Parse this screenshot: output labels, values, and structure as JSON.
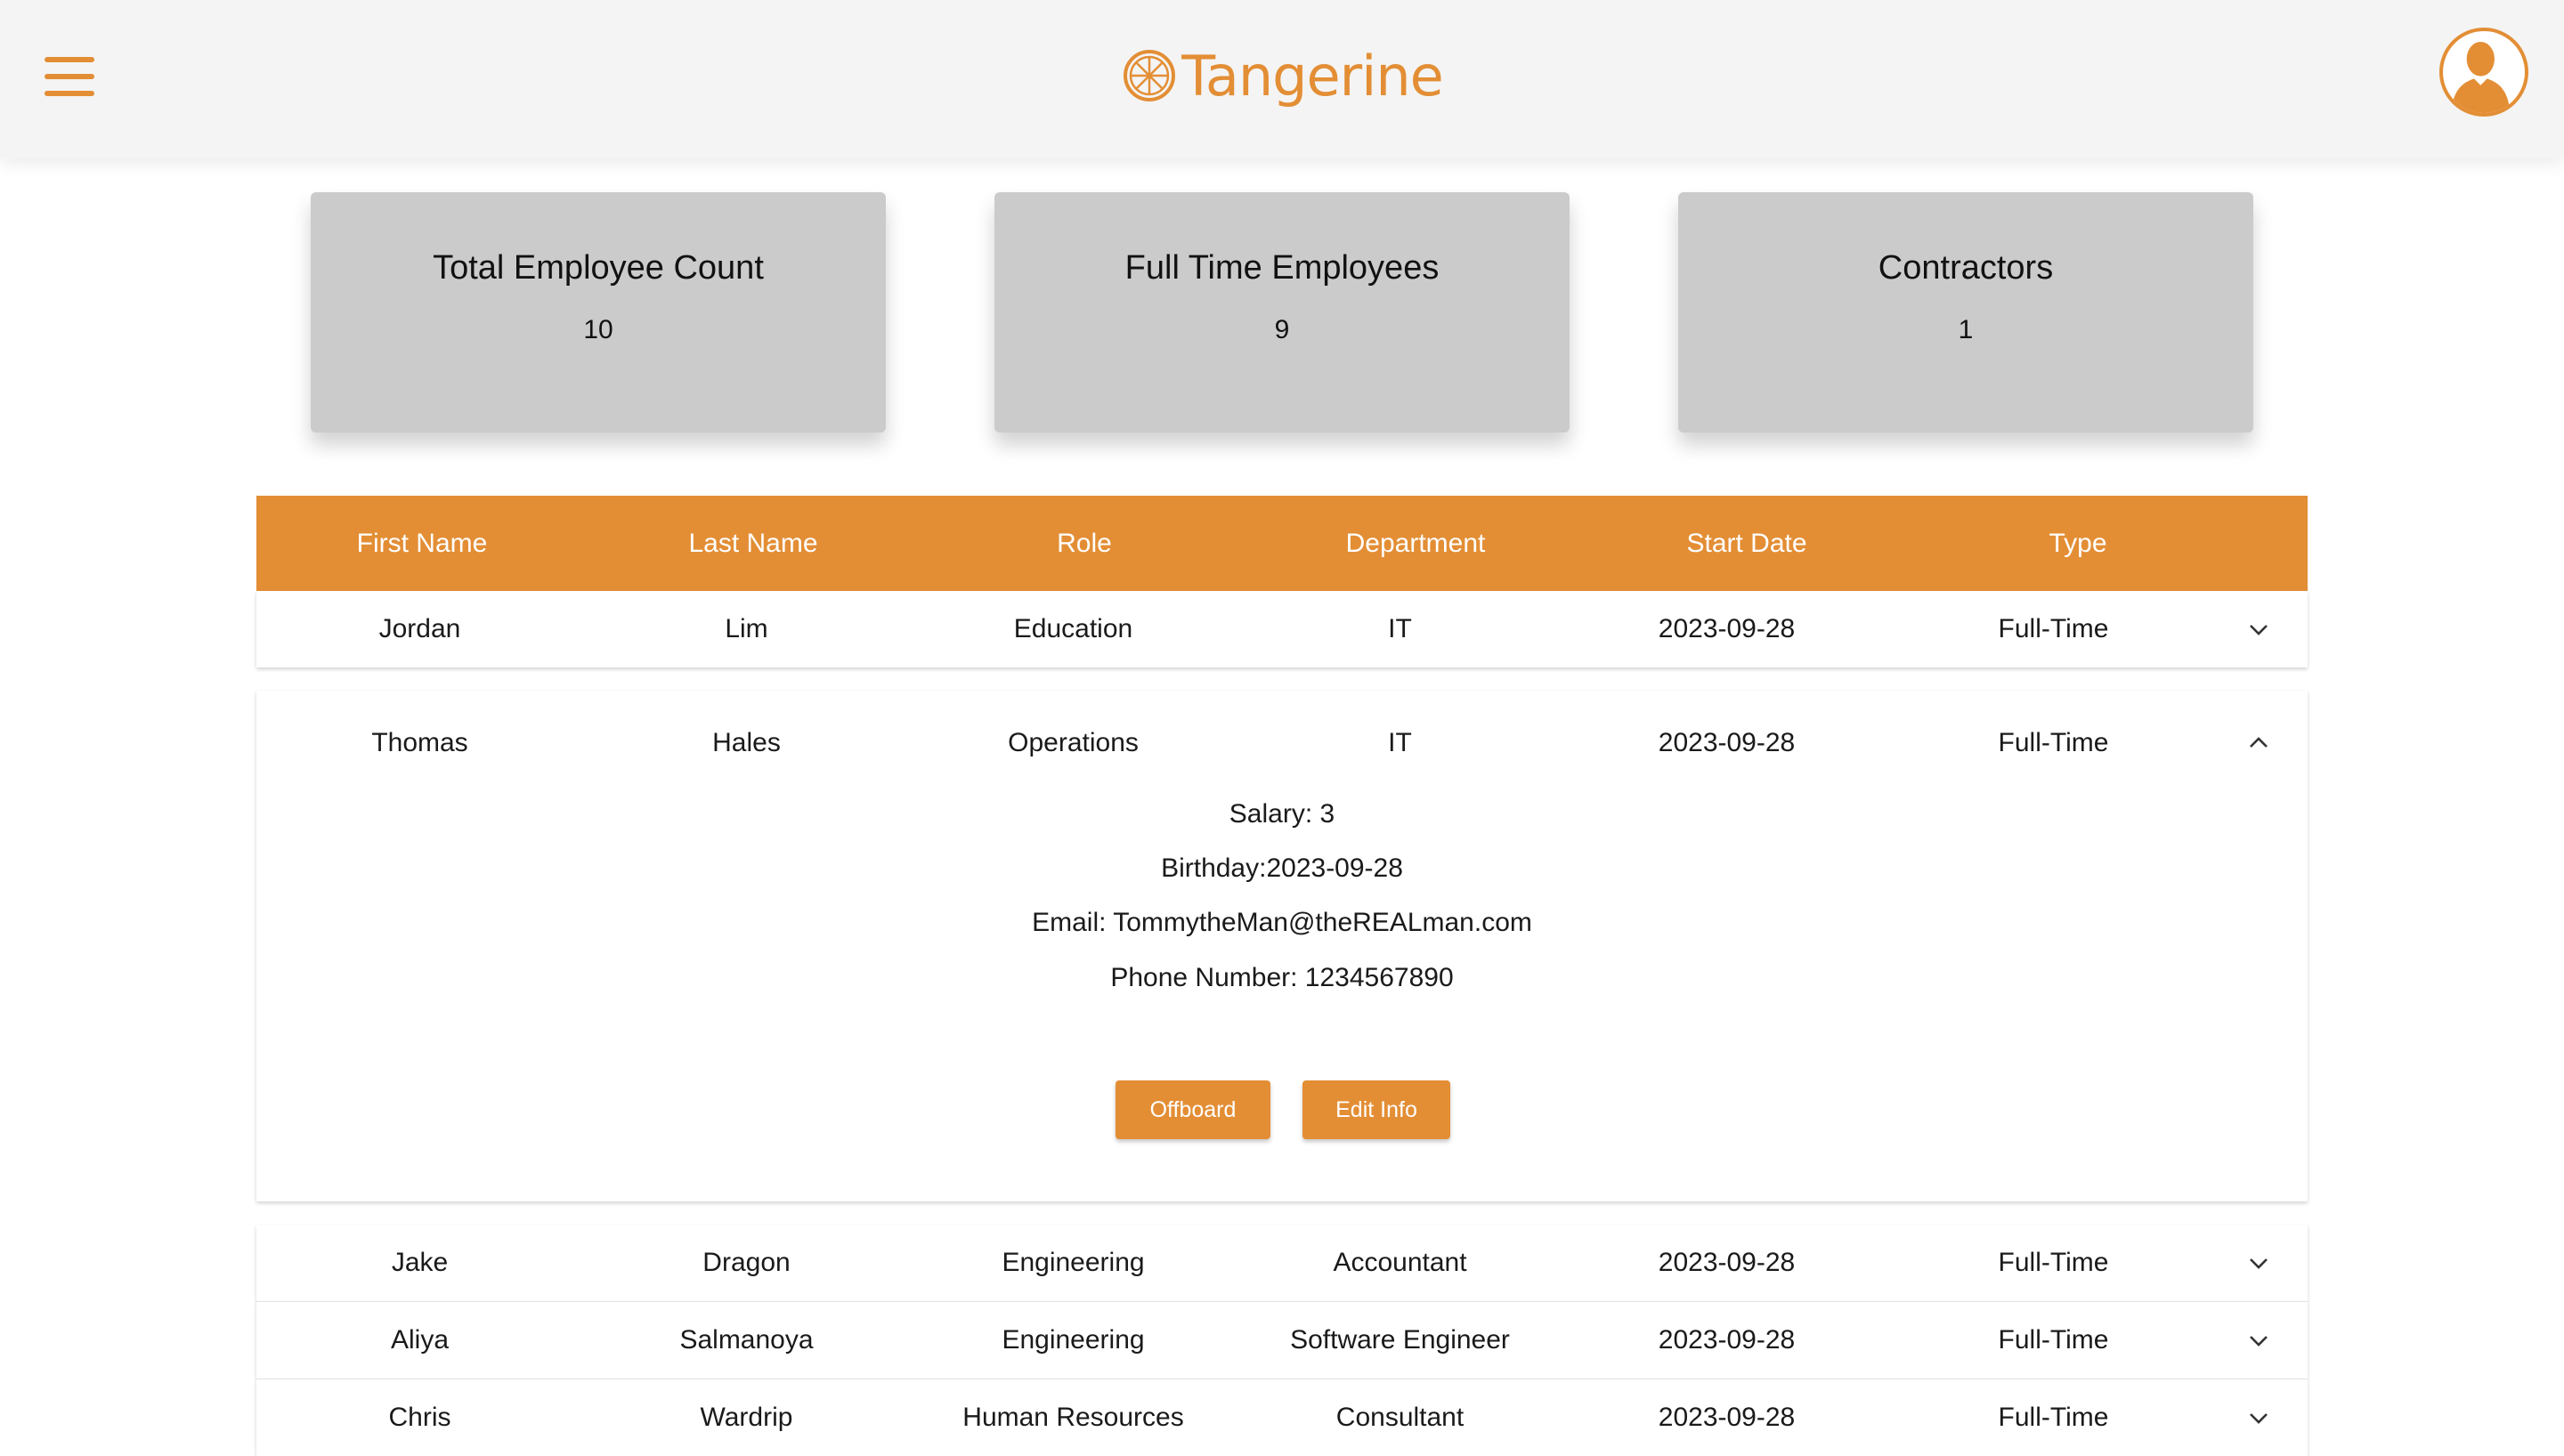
{
  "header": {
    "brand": "Tangerine",
    "menu_icon": "hamburger-menu-icon",
    "logo_icon": "tangerine-slice-icon",
    "avatar_icon": "user-avatar-icon",
    "accent_color": "#e38e35"
  },
  "stats": [
    {
      "title": "Total Employee Count",
      "value": "10"
    },
    {
      "title": "Full Time Employees",
      "value": "9"
    },
    {
      "title": "Contractors",
      "value": "1"
    }
  ],
  "table": {
    "columns": [
      "First Name",
      "Last Name",
      "Role",
      "Department",
      "Start Date",
      "Type"
    ],
    "rows": [
      {
        "first": "Jordan",
        "last": "Lim",
        "role": "Education",
        "department": "IT",
        "start": "2023-09-28",
        "type": "Full-Time",
        "expanded": false
      },
      {
        "first": "Thomas",
        "last": "Hales",
        "role": "Operations",
        "department": "IT",
        "start": "2023-09-28",
        "type": "Full-Time",
        "expanded": true,
        "details": {
          "salary": "Salary: 3",
          "birthday": "Birthday:2023-09-28",
          "email": "Email: TommytheMan@theREALman.com",
          "phone": "Phone Number: 1234567890"
        },
        "actions": {
          "offboard": "Offboard",
          "edit": "Edit Info"
        }
      },
      {
        "first": "Jake",
        "last": "Dragon",
        "role": "Engineering",
        "department": "Accountant",
        "start": "2023-09-28",
        "type": "Full-Time",
        "expanded": false
      },
      {
        "first": "Aliya",
        "last": "Salmanoya",
        "role": "Engineering",
        "department": "Software Engineer",
        "start": "2023-09-28",
        "type": "Full-Time",
        "expanded": false
      },
      {
        "first": "Chris",
        "last": "Wardrip",
        "role": "Human Resources",
        "department": "Consultant",
        "start": "2023-09-28",
        "type": "Full-Time",
        "expanded": false
      }
    ]
  }
}
